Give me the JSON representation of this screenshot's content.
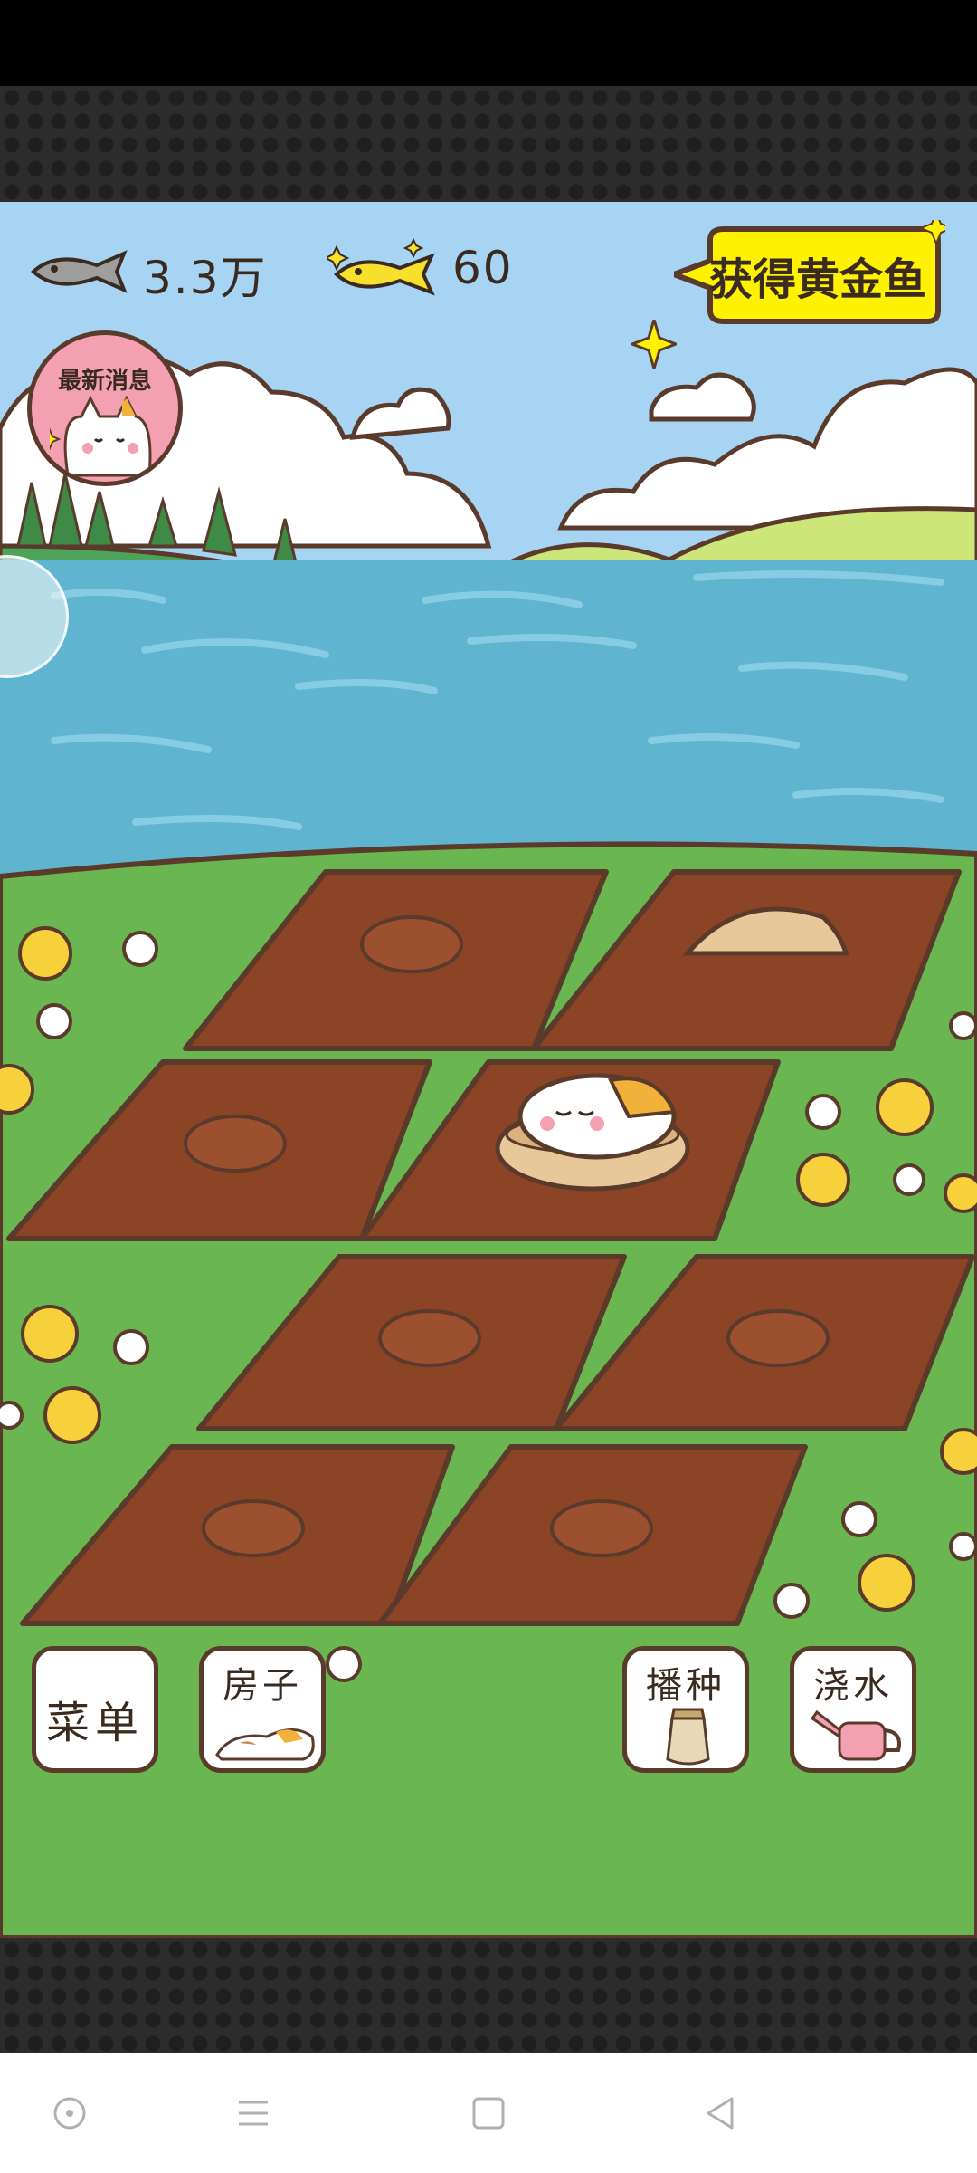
{
  "hud": {
    "fish_count": "3.3万",
    "gold_fish_count": "60",
    "golden_fish_button": "获得黄金鱼",
    "news_button": "最新消息"
  },
  "buttons": {
    "menu": "菜单",
    "house": "房子",
    "sow": "播种",
    "water": "浇水"
  },
  "icons": {
    "fish": "fish-icon",
    "gold_fish": "gold-fish-icon",
    "cat_in_basket": "cat-in-basket-icon",
    "seed_bag": "seed-bag-icon",
    "watering_can": "watering-can-icon"
  },
  "colors": {
    "sky": "#a6d4f2",
    "lake": "#5fb4cf",
    "grass": "#6ab651",
    "soil": "#8b4425",
    "outline": "#5a3a2a",
    "golden_button": "#fff200",
    "news_button": "#f4a0b3"
  }
}
